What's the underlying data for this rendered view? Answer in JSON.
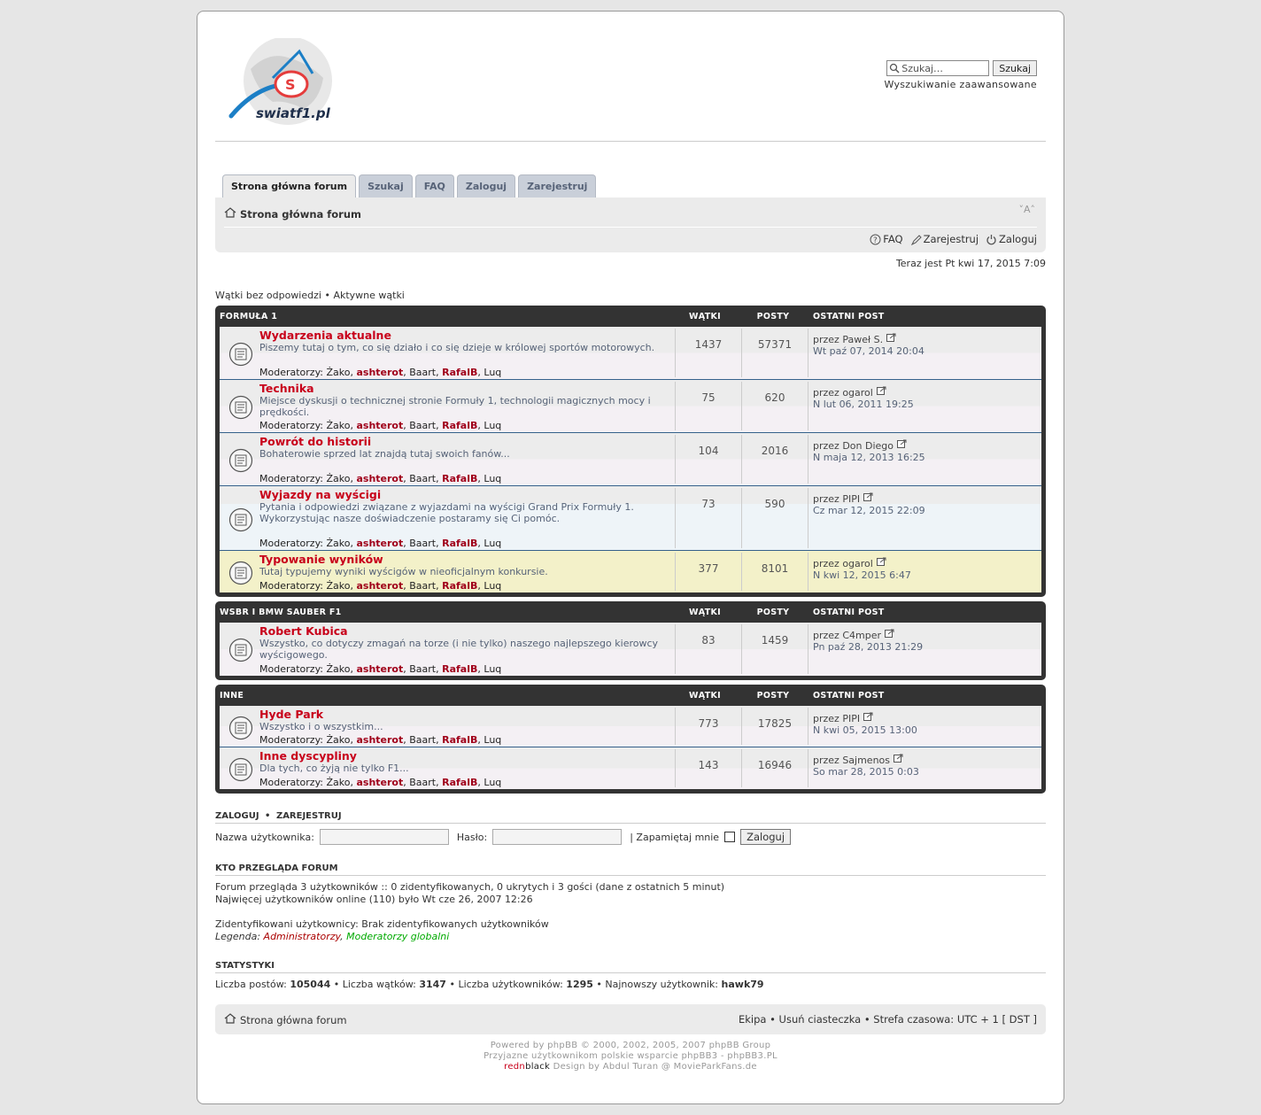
{
  "header": {
    "logo_text": "swiatf1.pl",
    "search_placeholder": "Szukaj…",
    "search_button": "Szukaj",
    "advanced_search": "Wyszukiwanie zaawansowane"
  },
  "tabs": [
    {
      "label": "Strona główna forum"
    },
    {
      "label": "Szukaj"
    },
    {
      "label": "FAQ"
    },
    {
      "label": "Zaloguj"
    },
    {
      "label": "Zarejestruj"
    }
  ],
  "navbar": {
    "breadcrumb": "Strona główna forum",
    "resize": "A",
    "links": {
      "faq": "FAQ",
      "register": "Zarejestruj",
      "login": "Zaloguj"
    }
  },
  "time_now": "Teraz jest Pt kwi 17, 2015 7:09",
  "quick_links": {
    "unanswered": "Wątki bez odpowiedzi",
    "sep": "•",
    "active": "Aktywne wątki"
  },
  "columns": {
    "topics": "Wątki",
    "posts": "Posty",
    "last_post": "Ostatni post"
  },
  "moderators_label": "Moderatorzy:",
  "moderators": [
    "Żako",
    "ashterot",
    "Baart",
    "RafalB",
    "Luq"
  ],
  "categories": [
    {
      "name": "Formuła 1",
      "forums": [
        {
          "title": "Wydarzenia aktualne",
          "desc": "Piszemy tutaj o tym, co się działo i co się dzieje w królowej sportów motorowych.",
          "topics": "1437",
          "posts": "57371",
          "last_by": "przez Paweł S.",
          "last_date": "Wt paź 07, 2014 20:04"
        },
        {
          "title": "Technika",
          "desc": "Miejsce dyskusji o technicznej stronie Formuły 1, technologii magicznych mocy i prędkości.",
          "topics": "75",
          "posts": "620",
          "last_by": "przez ogarol",
          "last_date": "N lut 06, 2011 19:25"
        },
        {
          "title": "Powrót do historii",
          "desc": "Bohaterowie sprzed lat znajdą tutaj swoich fanów...",
          "topics": "104",
          "posts": "2016",
          "last_by": "przez Don Diego",
          "last_date": "N maja 12, 2013 16:25"
        },
        {
          "title": "Wyjazdy na wyścigi",
          "desc": "Pytania i odpowiedzi związane z wyjazdami na wyścigi Grand Prix Formuły 1. Wykorzystując nasze doświadczenie postaramy się Ci pomóc.",
          "topics": "73",
          "posts": "590",
          "last_by": "przez PIPI",
          "last_date": "Cz mar 12, 2015 22:09"
        },
        {
          "title": "Typowanie wyników",
          "desc": "Tutaj typujemy wyniki wyścigów w nieoficjalnym konkursie.",
          "topics": "377",
          "posts": "8101",
          "last_by": "przez ogarol",
          "last_date": "N kwi 12, 2015 6:47"
        }
      ]
    },
    {
      "name": "WSBR i BMW Sauber F1",
      "forums": [
        {
          "title": "Robert Kubica",
          "desc": "Wszystko, co dotyczy zmagań na torze (i nie tylko) naszego najlepszego kierowcy wyścigowego.",
          "topics": "83",
          "posts": "1459",
          "last_by": "przez C4mper",
          "last_date": "Pn paź 28, 2013 21:29"
        }
      ]
    },
    {
      "name": "Inne",
      "forums": [
        {
          "title": "Hyde Park",
          "desc": "Wszystko i o wszystkim...",
          "topics": "773",
          "posts": "17825",
          "last_by": "przez PIPI",
          "last_date": "N kwi 05, 2015 13:00"
        },
        {
          "title": "Inne dyscypliny",
          "desc": "Dla tych, co żyją nie tylko F1...",
          "topics": "143",
          "posts": "16946",
          "last_by": "przez Sajmenos",
          "last_date": "So mar 28, 2015 0:03"
        }
      ]
    }
  ],
  "login": {
    "heading_login": "Zaloguj",
    "heading_sep": "•",
    "heading_register": "Zarejestruj",
    "username_label": "Nazwa użytkownika:",
    "password_label": "Hasło:",
    "remember_label": "| Zapamiętaj mnie",
    "button": "Zaloguj"
  },
  "who": {
    "heading": "Kto przegląda forum",
    "line1": "Forum przegląda 3 użytkowników :: 0 zidentyfikowanych, 0 ukrytych i 3 gości (dane z ostatnich 5 minut)",
    "line2": "Najwięcej użytkowników online (110) było Wt cze 26, 2007 12:26",
    "line3": "Zidentyfikowani użytkownicy: Brak zidentyfikowanych użytkowników",
    "legend_label": "Legenda:",
    "legend_admins": "Administratorzy",
    "legend_mods": "Moderatorzy globalni"
  },
  "stats": {
    "heading": "Statystyki",
    "posts_label": "Liczba postów:",
    "posts": "105044",
    "topics_label": "Liczba wątków:",
    "topics": "3147",
    "users_label": "Liczba użytkowników:",
    "users": "1295",
    "newest_label": "Najnowszy użytkownik:",
    "newest": "hawk79"
  },
  "footer": {
    "breadcrumb": "Strona główna forum",
    "right": "Ekipa • Usuń ciasteczka • Strefa czasowa: UTC + 1 [ DST ]",
    "copy1": "Powered by phpBB © 2000, 2002, 2005, 2007 phpBB Group",
    "copy2": "Przyjazne użytkownikom polskie wsparcie phpBB3 - phpBB3.PL",
    "copy3_red": "redn",
    "copy3_black": "black",
    "copy3_rest": " Design by Abdul Turan @ MovieParkFans.de"
  },
  "colors": {
    "accent_red": "#c8001a",
    "dark_header": "#333333",
    "row_border": "#35618b",
    "admin_red": "#aa0000",
    "mod_green": "#00aa00"
  }
}
